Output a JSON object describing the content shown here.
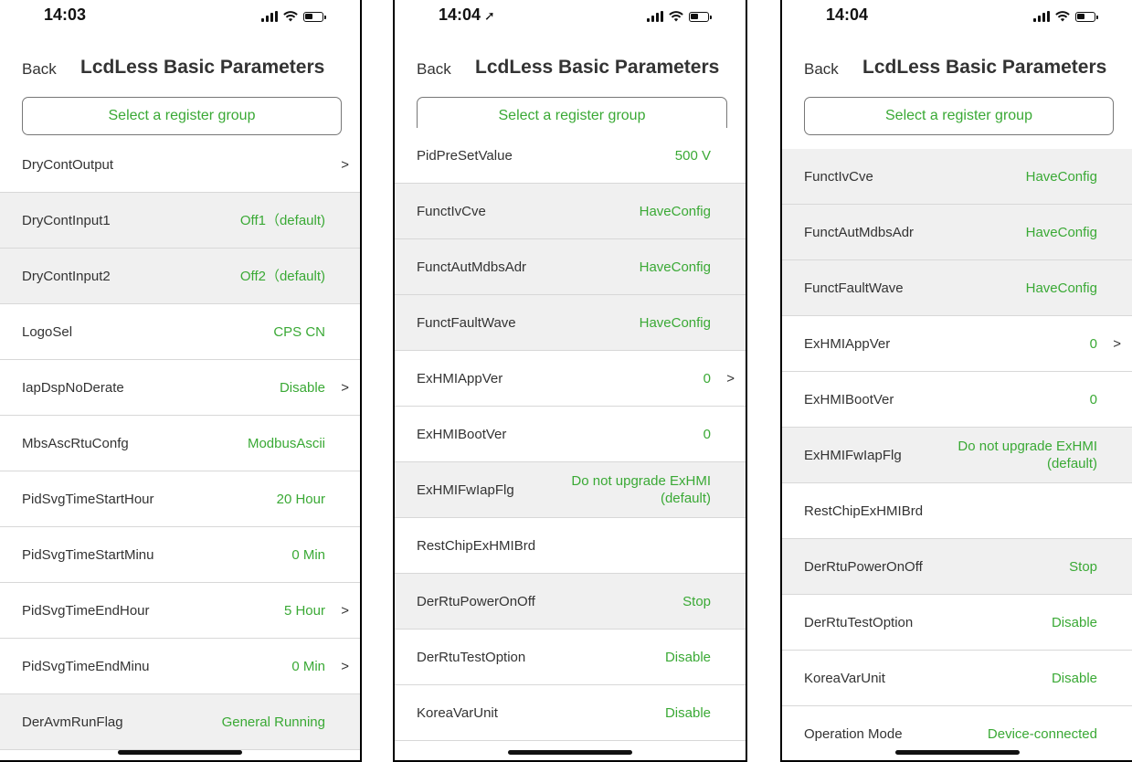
{
  "screens": [
    {
      "time": "14:03",
      "location_icon": "",
      "back_label": "Back",
      "title": "LcdLess Basic Parameters",
      "select_label": "Select a register group",
      "rows": [
        {
          "label": "DryContOutput",
          "value": "",
          "chev": ">",
          "gray": false
        },
        {
          "label": "DryContInput1",
          "value": "Off1（default)",
          "chev": "",
          "gray": true
        },
        {
          "label": "DryContInput2",
          "value": "Off2（default)",
          "chev": "",
          "gray": true
        },
        {
          "label": "LogoSel",
          "value": "CPS CN",
          "chev": "",
          "gray": false
        },
        {
          "label": "IapDspNoDerate",
          "value": "Disable",
          "chev": ">",
          "gray": false
        },
        {
          "label": "MbsAscRtuConfg",
          "value": "ModbusAscii",
          "chev": "",
          "gray": false
        },
        {
          "label": "PidSvgTimeStartHour",
          "value": "20 Hour",
          "chev": "",
          "gray": false
        },
        {
          "label": "PidSvgTimeStartMinu",
          "value": "0 Min",
          "chev": "",
          "gray": false
        },
        {
          "label": "PidSvgTimeEndHour",
          "value": "5 Hour",
          "chev": ">",
          "gray": false
        },
        {
          "label": "PidSvgTimeEndMinu",
          "value": "0 Min",
          "chev": ">",
          "gray": false
        },
        {
          "label": "DerAvmRunFlag",
          "value": "General Running",
          "chev": "",
          "gray": true
        }
      ]
    },
    {
      "time": "14:04",
      "location_icon": "➚",
      "back_label": "Back",
      "title": "LcdLess Basic Parameters",
      "select_label": "Select a register group",
      "rows": [
        {
          "label": "PidPreSetValue",
          "value": "500 V",
          "chev": "",
          "gray": false
        },
        {
          "label": "FunctIvCve",
          "value": "HaveConfig",
          "chev": "",
          "gray": true
        },
        {
          "label": "FunctAutMdbsAdr",
          "value": "HaveConfig",
          "chev": "",
          "gray": true
        },
        {
          "label": "FunctFaultWave",
          "value": "HaveConfig",
          "chev": "",
          "gray": true
        },
        {
          "label": "ExHMIAppVer",
          "value": "0",
          "chev": ">",
          "gray": false
        },
        {
          "label": "ExHMIBootVer",
          "value": "0",
          "chev": "",
          "gray": false
        },
        {
          "label": "ExHMIFwIapFlg",
          "value": "Do not upgrade ExHMI\n(default)",
          "chev": "",
          "gray": true
        },
        {
          "label": "RestChipExHMIBrd",
          "value": "",
          "chev": "",
          "gray": false
        },
        {
          "label": "DerRtuPowerOnOff",
          "value": "Stop",
          "chev": "",
          "gray": true
        },
        {
          "label": "DerRtuTestOption",
          "value": "Disable",
          "chev": "",
          "gray": false
        },
        {
          "label": "KoreaVarUnit",
          "value": "Disable",
          "chev": "",
          "gray": false
        }
      ]
    },
    {
      "time": "14:04",
      "location_icon": "",
      "back_label": "Back",
      "title": "LcdLess Basic Parameters",
      "select_label": "Select a register group",
      "rows": [
        {
          "label": "FunctIvCve",
          "value": "HaveConfig",
          "chev": "",
          "gray": true
        },
        {
          "label": "FunctAutMdbsAdr",
          "value": "HaveConfig",
          "chev": "",
          "gray": true
        },
        {
          "label": "FunctFaultWave",
          "value": "HaveConfig",
          "chev": "",
          "gray": true
        },
        {
          "label": "ExHMIAppVer",
          "value": "0",
          "chev": ">",
          "gray": false
        },
        {
          "label": "ExHMIBootVer",
          "value": "0",
          "chev": "",
          "gray": false
        },
        {
          "label": "ExHMIFwIapFlg",
          "value": "Do not upgrade ExHMI\n(default)",
          "chev": "",
          "gray": true
        },
        {
          "label": "RestChipExHMIBrd",
          "value": "",
          "chev": "",
          "gray": false
        },
        {
          "label": "DerRtuPowerOnOff",
          "value": "Stop",
          "chev": "",
          "gray": true
        },
        {
          "label": "DerRtuTestOption",
          "value": "Disable",
          "chev": "",
          "gray": false
        },
        {
          "label": "KoreaVarUnit",
          "value": "Disable",
          "chev": "",
          "gray": false
        },
        {
          "label": "Operation Mode",
          "value": "Device-connected",
          "chev": "",
          "gray": false
        }
      ]
    }
  ]
}
